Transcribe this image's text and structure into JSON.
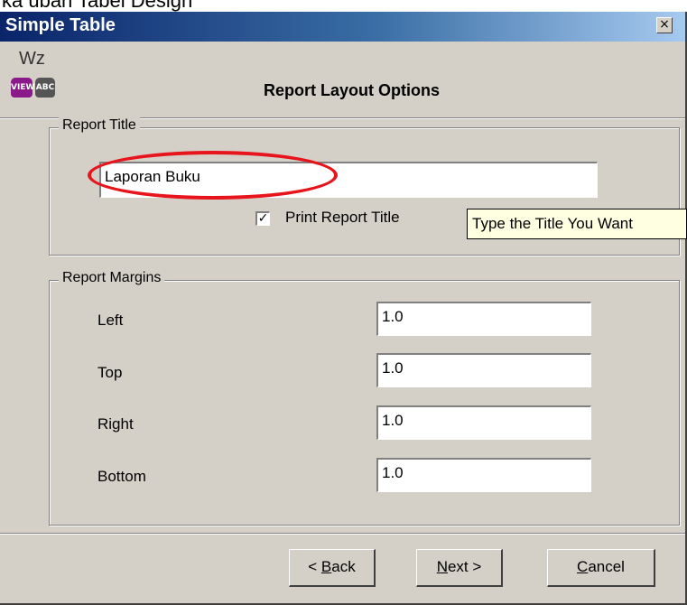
{
  "page_caption": "ka ubah Tabel Design",
  "window": {
    "title": "Simple Table",
    "close_glyph": "×"
  },
  "header": {
    "logo_text": "Wz",
    "logo_badges": [
      "VIEW",
      "ABC"
    ],
    "title": "Report Layout Options"
  },
  "report_title_group": {
    "legend": "Report Title",
    "title_value": "Laporan Buku",
    "print_checkbox": {
      "label": "Print Report Title",
      "checked": true,
      "mark": "✓"
    }
  },
  "tooltip": "Type the Title You Want",
  "margins_group": {
    "legend": "Report Margins",
    "fields": [
      {
        "label": "Left",
        "value": "1.0"
      },
      {
        "label": "Top",
        "value": "1.0"
      },
      {
        "label": "Right",
        "value": "1.0"
      },
      {
        "label": "Bottom",
        "value": "1.0"
      }
    ]
  },
  "buttons": {
    "back": {
      "prefix": "< ",
      "mnemonic": "B",
      "rest": "ack"
    },
    "next": {
      "mnemonic": "N",
      "rest": "ext >"
    },
    "cancel": {
      "mnemonic": "C",
      "rest": "ancel"
    }
  },
  "colors": {
    "dialog_face": "#d4d0c8",
    "title_bar_start": "#0a246a",
    "title_bar_end": "#a6caf0",
    "tooltip_bg": "#ffffe1",
    "annotation_red": "#e8141b"
  },
  "icons": [
    "close-icon",
    "checkmark-icon",
    "wizard-logo-icon"
  ]
}
